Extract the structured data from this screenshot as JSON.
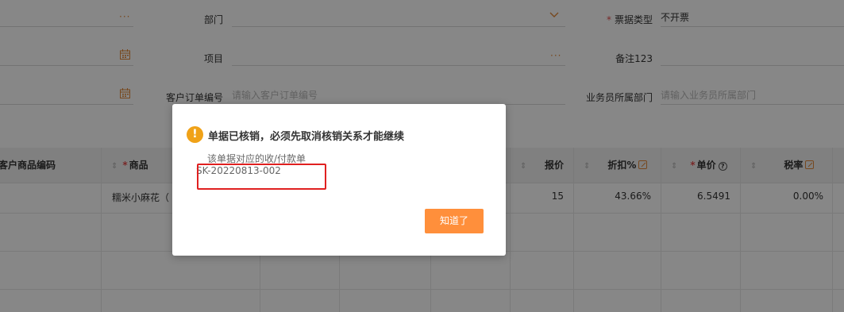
{
  "form": {
    "department": {
      "label": "部门",
      "value": ""
    },
    "invoice_type": {
      "label": "票据类型",
      "value": "不开票"
    },
    "project": {
      "label": "项目",
      "value": ""
    },
    "remark": {
      "label": "备注123",
      "value": ""
    },
    "customer_order_no": {
      "label": "客户订单编号",
      "placeholder": "请输入客户订单编号"
    },
    "salesman_dept": {
      "label": "业务员所属部门",
      "placeholder": "请输入业务员所属部门"
    },
    "ellipsis": "···"
  },
  "table": {
    "headers": {
      "customer_code": "客户商品编码",
      "product": "商品",
      "price": "报价",
      "discount": "折扣%",
      "unit_price": "单价",
      "tax_rate": "税率"
    },
    "rows": [
      {
        "product": "糯米小麻花（",
        "price": "15",
        "discount": "43.66%",
        "unit_price": "6.5491",
        "tax_rate": "0.00%"
      }
    ]
  },
  "dialog": {
    "title": "单据已核销，必须先取消核销关系才能继续",
    "description": "该单据对应的收/付款单",
    "code": "SK-20220813-002",
    "ok_label": "知道了",
    "warn_glyph": "!"
  },
  "colors": {
    "accent": "#ff8f3b",
    "warning": "#f0a218",
    "required": "#e34d4d",
    "highlight_box": "#e02020"
  }
}
